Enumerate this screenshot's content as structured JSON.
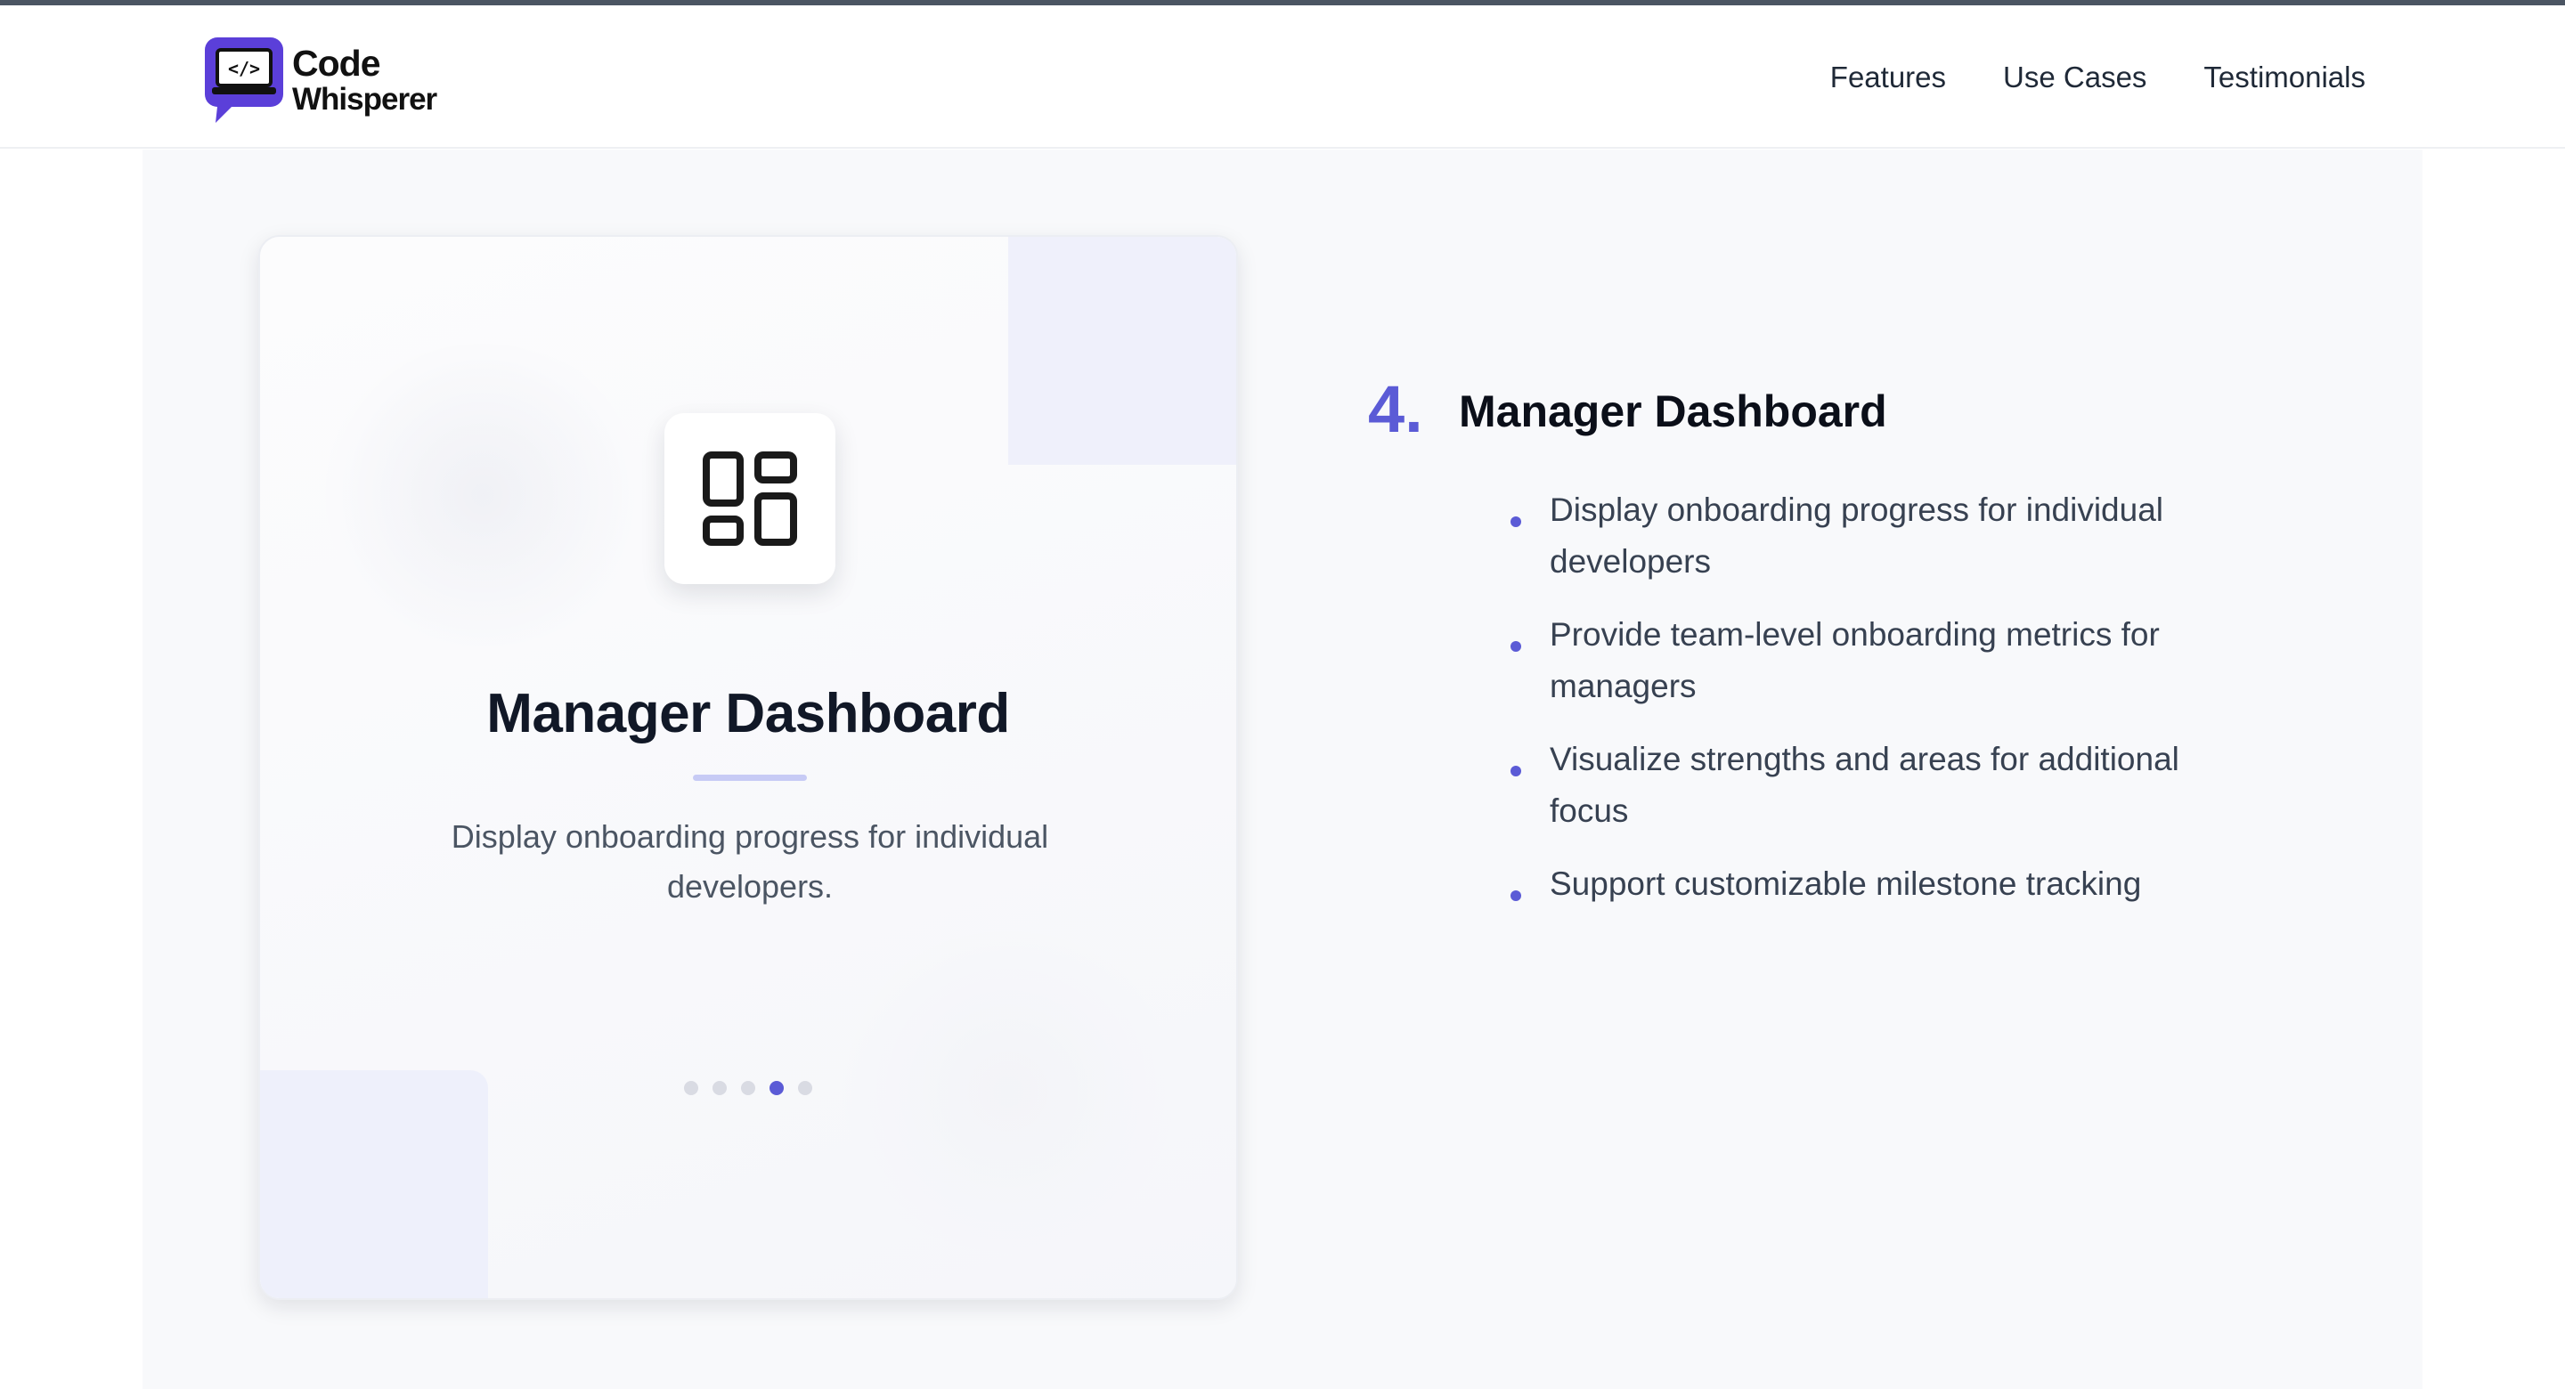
{
  "header": {
    "logo": {
      "line1": "Code",
      "line2": "Whisperer"
    },
    "nav": [
      {
        "label": "Features"
      },
      {
        "label": "Use Cases"
      },
      {
        "label": "Testimonials"
      }
    ]
  },
  "card": {
    "icon": "dashboard-grid-icon",
    "title": "Manager Dashboard",
    "description": "Display onboarding progress for individual developers.",
    "carousel": {
      "total": 5,
      "active_index": 4
    }
  },
  "feature": {
    "number": "4.",
    "title": "Manager Dashboard",
    "bullets": [
      "Display onboarding progress for individual developers",
      "Provide team-level onboarding metrics for managers",
      "Visualize strengths and areas for additional focus",
      "Support customizable milestone tracking"
    ]
  },
  "colors": {
    "accent": "#5b5bd6",
    "logo_purple": "#5b3fd9",
    "section_bg": "#f8f9fb",
    "text_dark": "#111827"
  }
}
